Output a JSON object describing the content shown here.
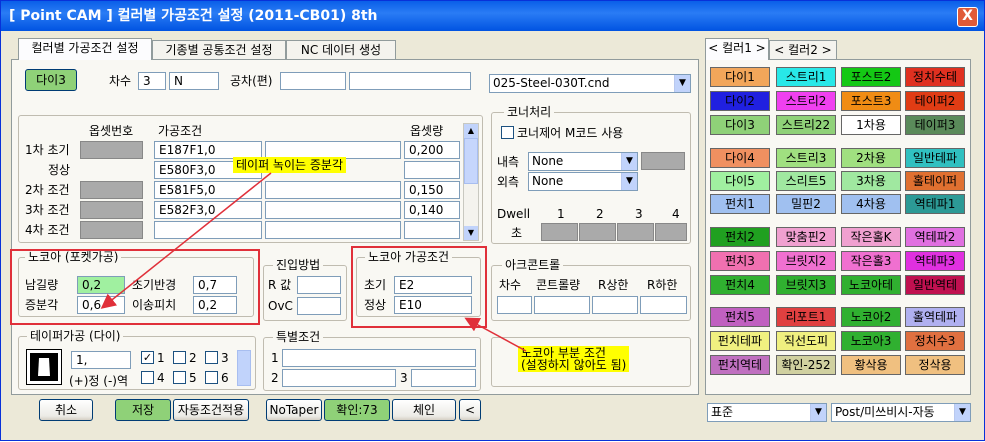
{
  "window": {
    "title": "[ Point CAM ]  컬러별 가공조건 설정  (2011-CB01) 8th",
    "close": "X"
  },
  "tabs": [
    "컬러별 가공조건 설정",
    "기종별 공통조건 설정",
    "NC 데이터 생성"
  ],
  "top": {
    "tool_button": "다이3",
    "order_label": "차수",
    "order_value": "3",
    "order_n": "N",
    "tolerance_label": "공차(편)",
    "tolerance_value": "",
    "file": "025-Steel-030T.cnd"
  },
  "table": {
    "col_offset_no": "옵셋번호",
    "col_condition": "가공조건",
    "col_offset_amt": "옵셋량",
    "rows": [
      {
        "label": "1차 초기",
        "cond": "E187F1,0",
        "amt": "0,200"
      },
      {
        "label": "정상",
        "cond": "E580F3,0",
        "amt": ""
      },
      {
        "label": "2차 조건",
        "cond": "E581F5,0",
        "amt": "0,150"
      },
      {
        "label": "3차 조건",
        "cond": "E582F3,0",
        "amt": "0,140"
      },
      {
        "label": "4차 조건",
        "cond": "",
        "amt": ""
      }
    ]
  },
  "pocket": {
    "title": "노코아 (포켓가공)",
    "remain_label": "남길량",
    "remain_value": "0,2",
    "init_radius_label": "초기반경",
    "init_radius_value": "0,7",
    "incr_label": "증분각",
    "incr_value": "0,6",
    "pitch_label": "이송피치",
    "pitch_value": "0,2"
  },
  "approach": {
    "title": "진입방법",
    "r_label": "R 값",
    "ovc_label": "OvC"
  },
  "nocore": {
    "title": "노코아 가공조건",
    "init_label": "초기",
    "init_value": "E2",
    "normal_label": "정상",
    "normal_value": "E10"
  },
  "taper": {
    "title": "테이퍼가공 (다이)",
    "value": "1,",
    "sign": "(+)정 (-)역",
    "checks": [
      "1",
      "2",
      "3",
      "4",
      "5",
      "6"
    ]
  },
  "special": {
    "title": "특별조건",
    "n1": "1",
    "n2": "2",
    "n3": "3"
  },
  "corner": {
    "title": "코너처리",
    "mcode": "코너제어 M코드 사용",
    "inner_label": "내측",
    "inner_value": "None",
    "outer_label": "외측",
    "outer_value": "None",
    "dwell_label": "Dwell",
    "sec_label": "초",
    "cols": [
      "1",
      "2",
      "3",
      "4"
    ]
  },
  "arc": {
    "title": "아크콘트롤",
    "order": "차수",
    "feed": "콘트롤량",
    "r_up": "R상한",
    "r_down": "R하한"
  },
  "annotations": {
    "taper_note": "테이퍼 녹이는 증분각",
    "nocore_note1": "노코아 부분 조건",
    "nocore_note2": "(설정하지 않아도 됨)"
  },
  "bottom": {
    "cancel": "취소",
    "save": "저장",
    "auto": "자동조건적용",
    "notaper": "NoTaper",
    "confirm": "확인:73",
    "chain": "체인",
    "back": "<"
  },
  "color_tabs": [
    "< 컬러1 >",
    "< 컬러2 >"
  ],
  "colors": [
    [
      [
        "다이1",
        "#f2a65a",
        "#000"
      ],
      [
        "스트리1",
        "#28e8e8",
        "#000"
      ],
      [
        "포스트2",
        "#14c814",
        "#000"
      ],
      [
        "정치수테",
        "#e03020",
        "#000"
      ]
    ],
    [
      [
        "다이2",
        "#2020e0",
        "#000"
      ],
      [
        "스트리2",
        "#f040f0",
        "#000"
      ],
      [
        "포스트3",
        "#f08c14",
        "#000"
      ],
      [
        "테이퍼2",
        "#e03c14",
        "#000"
      ]
    ],
    [
      [
        "다이3",
        "#8fd178",
        "#000"
      ],
      [
        "스트리22",
        "#8fd178",
        "#000"
      ],
      [
        "1차용",
        "#ffffff",
        "#000"
      ],
      [
        "테이퍼3",
        "#5a8a5a",
        "#000"
      ]
    ],
    [
      [
        "다이4",
        "#f09060",
        "#000"
      ],
      [
        "스트리3",
        "#a0e080",
        "#000"
      ],
      [
        "2차용",
        "#a0e080",
        "#000"
      ],
      [
        "일반테파",
        "#30c0c0",
        "#000"
      ]
    ],
    [
      [
        "다이5",
        "#a0f0a0",
        "#000"
      ],
      [
        "스리트5",
        "#a0e8a0",
        "#000"
      ],
      [
        "3차용",
        "#a0e8a0",
        "#000"
      ],
      [
        "홀테이퍼",
        "#e07030",
        "#000"
      ]
    ],
    [
      [
        "펀치1",
        "#a0c0f0",
        "#000"
      ],
      [
        "밀핀2",
        "#a0c0f0",
        "#000"
      ],
      [
        "4차용",
        "#a0c0f0",
        "#000"
      ],
      [
        "역테파1",
        "#2c9a96",
        "#000"
      ]
    ],
    [
      [
        "펀치2",
        "#20a020",
        "#000"
      ],
      [
        "맞춤핀2",
        "#f0a0d0",
        "#000"
      ],
      [
        "작은홀K",
        "#f0a0d0",
        "#000"
      ],
      [
        "역테파2",
        "#e070e0",
        "#000"
      ]
    ],
    [
      [
        "펀치3",
        "#f070b0",
        "#000"
      ],
      [
        "브릿지2",
        "#f070d0",
        "#000"
      ],
      [
        "작은홀3",
        "#f070d0",
        "#000"
      ],
      [
        "역테파3",
        "#e030e0",
        "#000"
      ]
    ],
    [
      [
        "펀치4",
        "#30b030",
        "#000"
      ],
      [
        "브릿지3",
        "#30b030",
        "#000"
      ],
      [
        "노코아테",
        "#30b030",
        "#000"
      ],
      [
        "일반역테",
        "#c01050",
        "#000"
      ]
    ],
    [
      [
        "펀치5",
        "#c060c0",
        "#000"
      ],
      [
        "리포트1",
        "#e04040",
        "#000"
      ],
      [
        "노코아2",
        "#30b030",
        "#000"
      ],
      [
        "홀역테파",
        "#b0b0f0",
        "#000"
      ]
    ],
    [
      [
        "펀치테파",
        "#f0f080",
        "#000"
      ],
      [
        "직선도피",
        "#f0f080",
        "#000"
      ],
      [
        "노코아3",
        "#30b030",
        "#000"
      ],
      [
        "정치수3",
        "#e07040",
        "#000"
      ]
    ],
    [
      [
        "펀치역테",
        "#c070c0",
        "#000"
      ],
      [
        "확인-252",
        "#d0d0a0",
        "#000"
      ],
      [
        "황삭용",
        "#f0c080",
        "#000"
      ],
      [
        "정삭용",
        "#f0c080",
        "#000"
      ]
    ]
  ],
  "right_bottom": {
    "std": "표준",
    "post": "Post/미쓰비시-자동"
  }
}
